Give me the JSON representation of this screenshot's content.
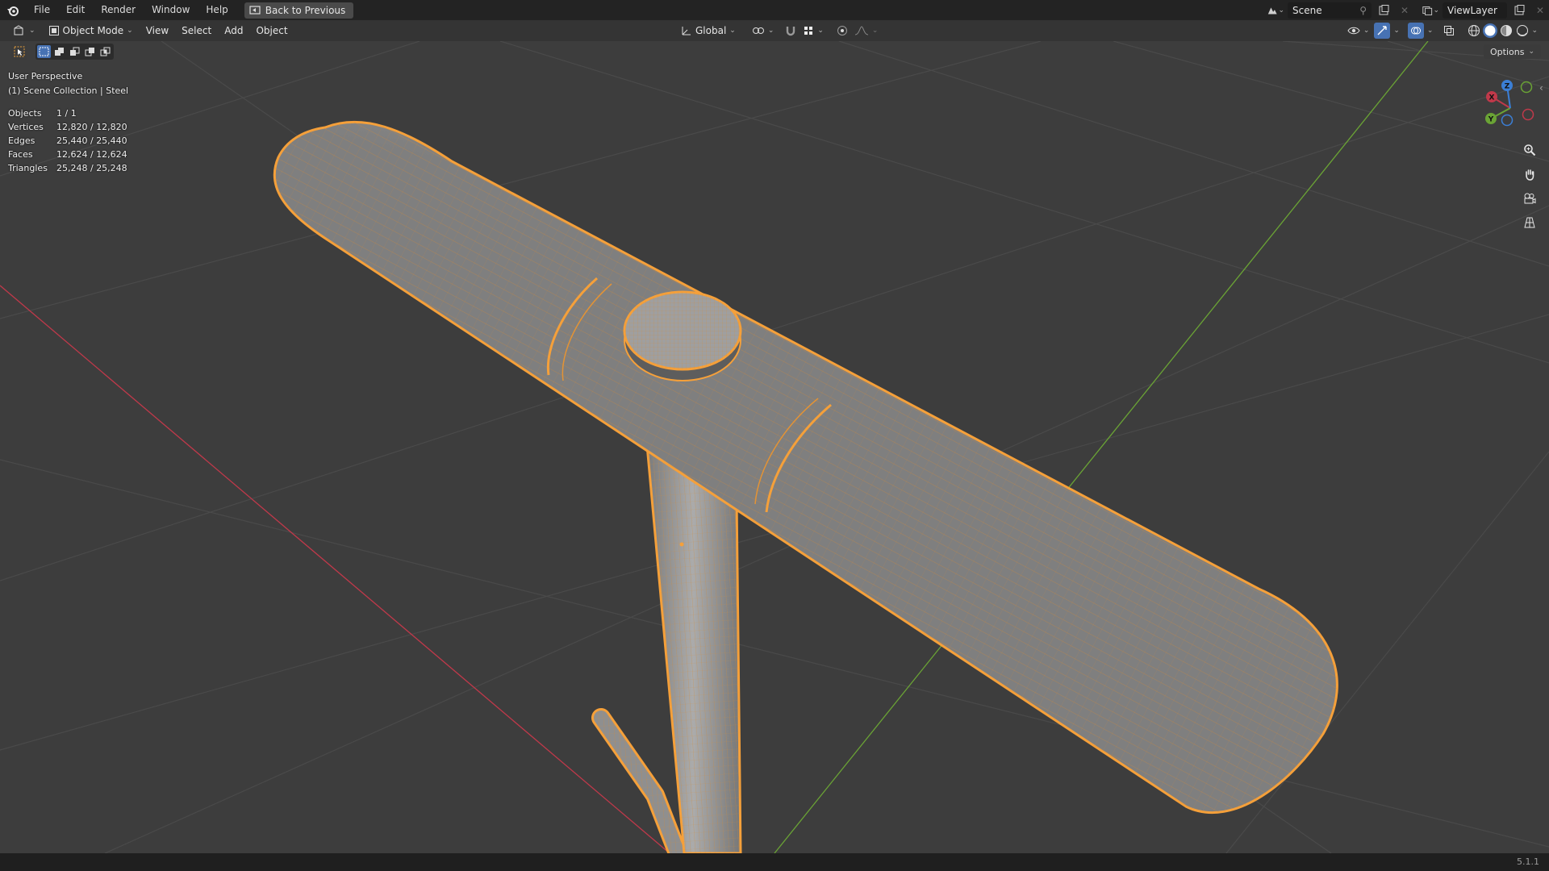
{
  "menu": {
    "items": [
      "File",
      "Edit",
      "Render",
      "Window",
      "Help"
    ],
    "back_button": "Back to Previous"
  },
  "top_right": {
    "scene": "Scene",
    "view_layer": "ViewLayer"
  },
  "viewport_header": {
    "mode": "Object Mode",
    "menus": [
      "View",
      "Select",
      "Add",
      "Object"
    ],
    "orientation": "Global",
    "options_label": "Options"
  },
  "overlay": {
    "view_name": "User Perspective",
    "collection": "(1) Scene Collection | Steel",
    "stats": [
      {
        "label": "Objects",
        "value": "1 / 1"
      },
      {
        "label": "Vertices",
        "value": "12,820 / 12,820"
      },
      {
        "label": "Edges",
        "value": "25,440 / 25,440"
      },
      {
        "label": "Faces",
        "value": "12,624 / 12,624"
      },
      {
        "label": "Triangles",
        "value": "25,248 / 25,248"
      }
    ]
  },
  "gizmo": {
    "x": "X",
    "y": "Y",
    "z": "Z"
  },
  "status": {
    "version": "5.1.1"
  },
  "colors": {
    "selection_outline": "#f5a03a",
    "mesh_fill": "#a9a9a9",
    "x_axis": "#c0394a",
    "y_axis": "#6aa335",
    "z_axis": "#3b7fd6",
    "viewport_bg": "#3d3d3d"
  }
}
